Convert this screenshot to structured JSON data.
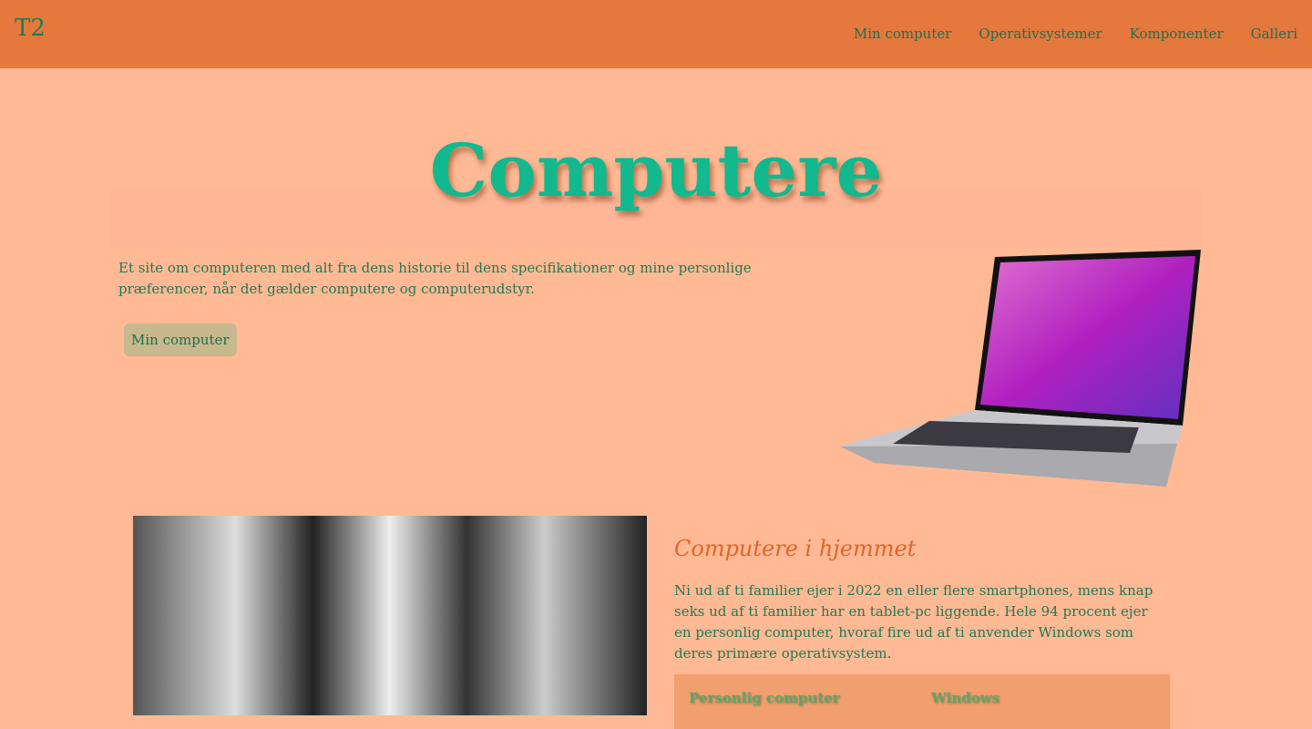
{
  "nav": {
    "logo": "T2",
    "links": [
      "Min computer",
      "Operativsystemer",
      "Komponenter",
      "Galleri"
    ]
  },
  "hero": {
    "title": "Computere",
    "intro": "Et site om computeren med alt fra dens historie til dens specifikationer og mine personlige præferencer, når det gælder computere og computerudstyr.",
    "button": "Min computer"
  },
  "section": {
    "heading": "Computere i hjemmet",
    "text": "Ni ud af ti familier ejer i 2022 en eller flere smartphones, mens knap seks ud af ti familier har en tablet-pc liggende. Hele 94 procent ejer en personlig computer, hvoraf fire ud af ti anvender Windows som deres primære operativsystem.",
    "table": {
      "headers": [
        "Personlig computer",
        "Windows"
      ]
    }
  }
}
